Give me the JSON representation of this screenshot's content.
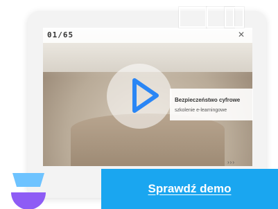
{
  "slide": {
    "counter": "01/65"
  },
  "video": {
    "caption_line1": "Bezpieczeństwo cyfrowe",
    "caption_line2": "szkolenie e-learningowe"
  },
  "cta": {
    "label": "Sprawdź demo"
  },
  "colors": {
    "accent": "#1aa6f0",
    "play": "#2a86f5",
    "logo_top": "#6ec3ff",
    "logo_bottom": "#8e5cf5"
  },
  "icons": {
    "play": "play-icon",
    "close": "close-icon",
    "next": "next-arrows-icon",
    "logo": "brand-logo-icon"
  }
}
